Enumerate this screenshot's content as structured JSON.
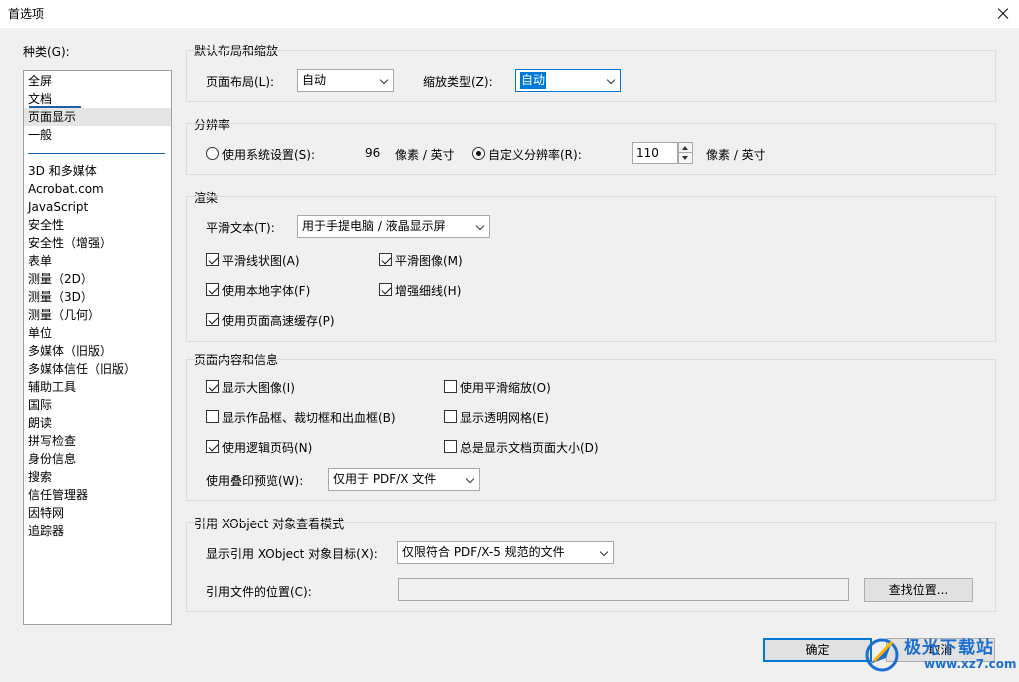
{
  "window": {
    "title": "首选项"
  },
  "categories": {
    "label": "种类(G):",
    "items": [
      "全屏",
      "文档",
      "页面显示",
      "一般",
      "3D 和多媒体",
      "Acrobat.com",
      "JavaScript",
      "安全性",
      "安全性（增强）",
      "表单",
      "测量（2D）",
      "测量（3D）",
      "测量（几何）",
      "单位",
      "多媒体（旧版）",
      "多媒体信任（旧版）",
      "辅助工具",
      "国际",
      "朗读",
      "拼写检查",
      "身份信息",
      "搜索",
      "信任管理器",
      "因特网",
      "追踪器"
    ],
    "selected": "页面显示"
  },
  "layout_group": {
    "title": "默认布局和缩放",
    "page_layout_label": "页面布局(L):",
    "page_layout_value": "自动",
    "zoom_type_label": "缩放类型(Z):",
    "zoom_type_value": "自动"
  },
  "resolution_group": {
    "title": "分辨率",
    "system_label": "使用系统设置(S):",
    "system_value": "96",
    "unit1": "像素 / 英寸",
    "custom_label": "自定义分辨率(R):",
    "custom_value": "110",
    "unit2": "像素 / 英寸"
  },
  "render_group": {
    "title": "渲染",
    "smooth_text_label": "平滑文本(T):",
    "smooth_text_value": "用于手提电脑 / 液晶显示屏",
    "smooth_line": "平滑线状图(A)",
    "smooth_image": "平滑图像(M)",
    "local_fonts": "使用本地字体(F)",
    "enhance_thin": "增强细线(H)",
    "page_cache": "使用页面高速缓存(P)"
  },
  "content_group": {
    "title": "页面内容和信息",
    "show_large_images": "显示大图像(I)",
    "smooth_zoom": "使用平滑缩放(O)",
    "show_art_trim": "显示作品框、裁切框和出血框(B)",
    "show_transparency_grid": "显示透明网格(E)",
    "logical_page_numbers": "使用逻辑页码(N)",
    "always_show_size": "总是显示文档页面大小(D)",
    "overprint_label": "使用叠印预览(W):",
    "overprint_value": "仅用于 PDF/X 文件"
  },
  "xobject_group": {
    "title": "引用 XObject 对象查看模式",
    "show_target_label": "显示引用 XObject 对象目标(X):",
    "show_target_value": "仅限符合 PDF/X-5 规范的文件",
    "location_label": "引用文件的位置(C):",
    "browse_button": "查找位置..."
  },
  "buttons": {
    "ok": "确定",
    "cancel": "取消"
  },
  "watermark": {
    "brand": "极光下载站",
    "url": "www.xz7.com"
  }
}
